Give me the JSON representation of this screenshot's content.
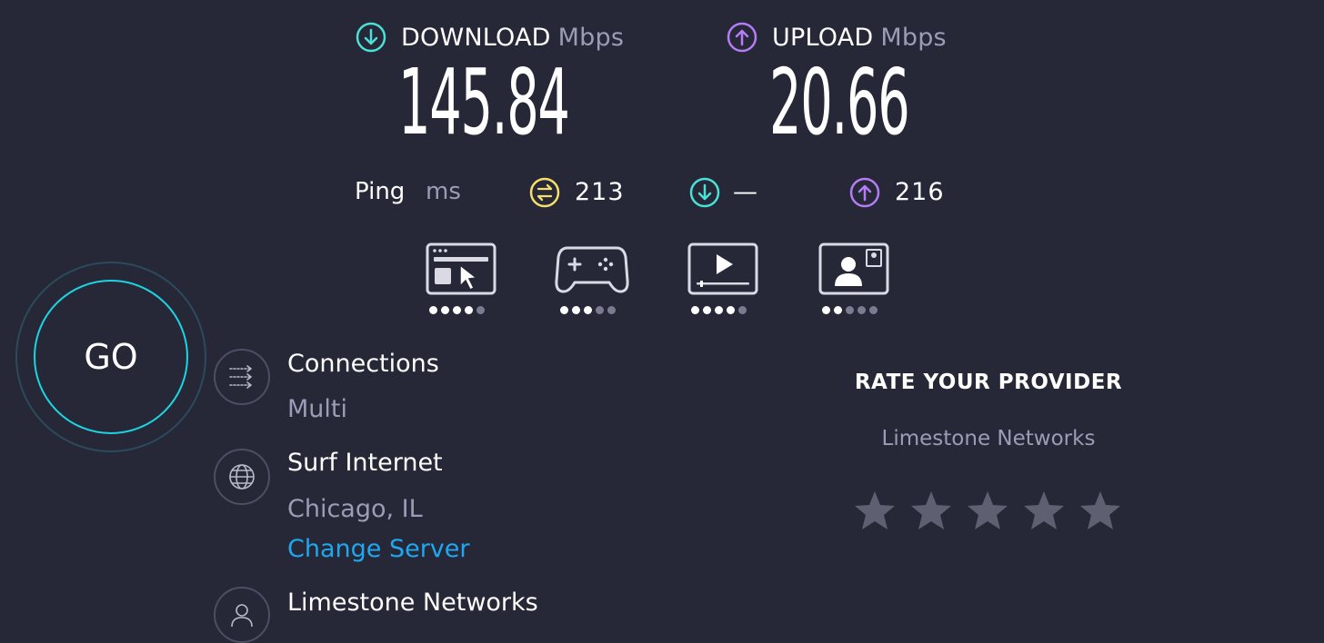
{
  "download": {
    "label": "DOWNLOAD",
    "unit": "Mbps",
    "value": "145.84",
    "color": "#4be0d6",
    "icon": "arrow-down-circle-icon"
  },
  "upload": {
    "label": "UPLOAD",
    "unit": "Mbps",
    "value": "20.66",
    "color": "#b47cf5",
    "icon": "arrow-up-circle-icon"
  },
  "ping": {
    "label": "Ping",
    "unit": "ms",
    "idle": {
      "value": "213",
      "color": "#f5df6a",
      "icon": "ping-idle-icon"
    },
    "download": {
      "value": "—",
      "color": "#4be0d6",
      "icon": "arrow-down-circle-icon"
    },
    "upload": {
      "value": "216",
      "color": "#b47cf5",
      "icon": "arrow-up-circle-icon"
    }
  },
  "use_cases": [
    {
      "name": "web-browsing",
      "icon": "browser-cursor-icon",
      "rating": 4,
      "max": 5
    },
    {
      "name": "gaming",
      "icon": "gamepad-icon",
      "rating": 3,
      "max": 5
    },
    {
      "name": "video-streaming",
      "icon": "video-play-icon",
      "rating": 4,
      "max": 5
    },
    {
      "name": "video-chat",
      "icon": "video-call-icon",
      "rating": 2,
      "max": 5
    }
  ],
  "go_button": {
    "label": "GO"
  },
  "connections": {
    "title": "Connections",
    "value": "Multi",
    "icon": "connections-icon"
  },
  "server": {
    "title": "Surf Internet",
    "location": "Chicago, IL",
    "change_label": "Change Server",
    "icon": "globe-icon"
  },
  "provider": {
    "title": "Limestone Networks",
    "icon": "person-icon"
  },
  "rate_provider": {
    "title": "RATE YOUR PROVIDER",
    "provider": "Limestone Networks",
    "stars": 5,
    "rating": 0
  },
  "colors": {
    "background": "#262838",
    "accent_cyan": "#1ed3e0",
    "link": "#1fa8f0",
    "muted": "#9a9db5"
  }
}
